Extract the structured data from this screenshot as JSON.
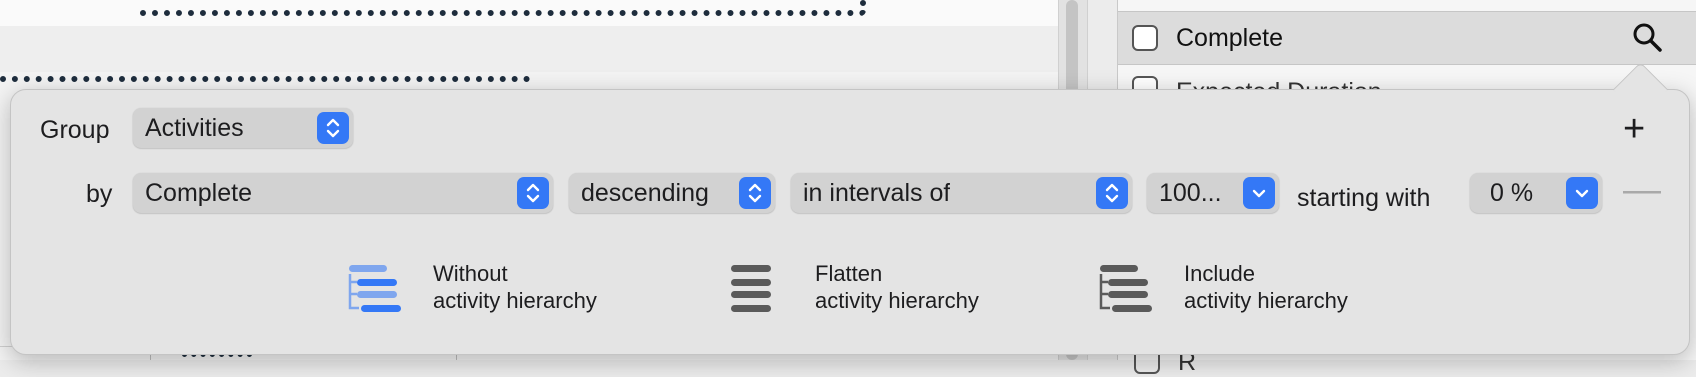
{
  "sidebar_list": {
    "complete_label": "Complete",
    "next_label": "Expected Duration",
    "bottom_label": "R"
  },
  "group_popover": {
    "group_label": "Group",
    "group_value": "Activities",
    "by_label": "by",
    "field_value": "Complete",
    "order_value": "descending",
    "interval_mode_value": "in intervals of",
    "interval_value": "100...",
    "starting_with_label": "starting with",
    "start_value": "0 %",
    "add_symbol": "+",
    "remove_symbol": "—",
    "options": [
      {
        "line1": "Without",
        "line2": "activity hierarchy",
        "icon": "hierarchy-without-icon"
      },
      {
        "line1": "Flatten",
        "line2": "activity hierarchy",
        "icon": "hierarchy-flatten-icon"
      },
      {
        "line1": "Include",
        "line2": "activity hierarchy",
        "icon": "hierarchy-include-icon"
      }
    ]
  },
  "colors": {
    "accent": "#3478f6",
    "popover_bg": "#e4e4e4",
    "popup_bg": "#d2d2d2",
    "icon_gray": "#5a5a5a",
    "icon_light_blue": "#7fa6ee"
  }
}
